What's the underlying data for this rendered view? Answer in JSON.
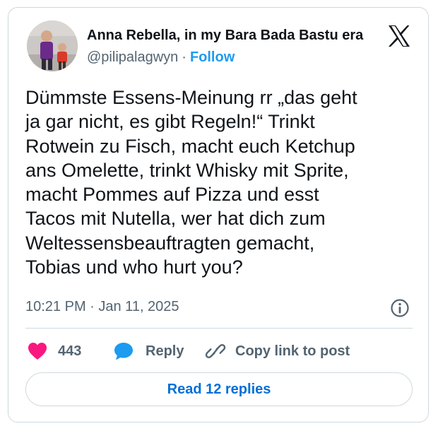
{
  "author": {
    "display_name": "Anna Rebella, in my Bara Bada Bastu era",
    "handle": "@pilipalagwyn",
    "separator": "·",
    "follow_label": "Follow"
  },
  "tweet": {
    "lines": [
      "Dümmste Essens-Meinung rr „das geht",
      "ja gar nicht, es gibt Regeln!“ Trinkt",
      "Rotwein zu Fisch, macht euch Ketchup",
      "ans Omelette, trinkt Whisky mit Sprite,",
      "macht Pommes auf Pizza und esst",
      "Tacos mit Nutella, wer hat dich zum",
      "Weltessensbeauftragten gemacht,",
      "Tobias und who hurt you?"
    ],
    "timestamp": "10:21 PM · Jan 11, 2025"
  },
  "actions": {
    "like_count": "443",
    "reply_label": "Reply",
    "copy_label": "Copy link to post"
  },
  "read_replies_label": "Read 12 replies",
  "icons": {
    "logo": "x-logo-icon",
    "info": "info-icon",
    "like": "heart-icon",
    "reply": "speech-bubble-icon",
    "copy": "link-icon"
  },
  "colors": {
    "text": "#0f1419",
    "secondary": "#536471",
    "accent": "#1d9bf0",
    "heart": "#f91880",
    "border": "#cfd9de"
  }
}
